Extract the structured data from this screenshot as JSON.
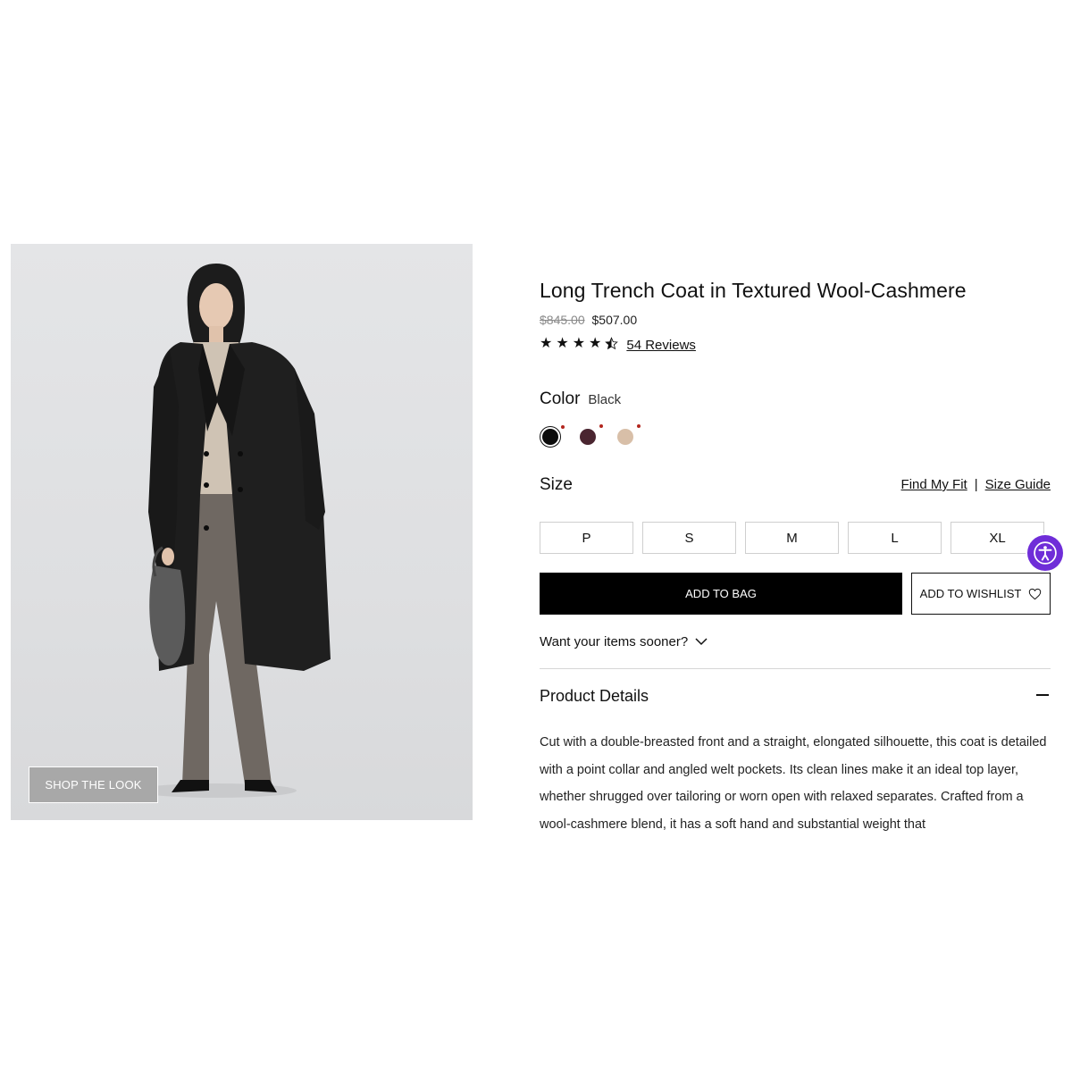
{
  "product": {
    "title": "Long Trench Coat in Textured Wool-Cashmere",
    "price_original": "$845.00",
    "price_sale": "$507.00",
    "rating": 4.5,
    "reviews_label": "54 Reviews"
  },
  "image": {
    "shop_the_look_label": "SHOP THE LOOK"
  },
  "color": {
    "label": "Color",
    "selected_value": "Black",
    "swatches": [
      {
        "name": "black",
        "hex": "#0b0b0b",
        "selected": true
      },
      {
        "name": "burgundy",
        "hex": "#4a2530",
        "selected": false
      },
      {
        "name": "camel",
        "hex": "#d8bfa8",
        "selected": false
      }
    ]
  },
  "size": {
    "label": "Size",
    "find_fit_label": "Find My Fit",
    "separator": "|",
    "size_guide_label": "Size Guide",
    "options": [
      "P",
      "S",
      "M",
      "L",
      "XL"
    ]
  },
  "actions": {
    "add_to_bag": "ADD TO BAG",
    "add_to_wishlist": "ADD TO WISHLIST"
  },
  "delivery": {
    "sooner_label": "Want your items sooner?"
  },
  "details": {
    "title": "Product Details",
    "body": "Cut with a double-breasted front and a straight, elongated silhouette, this coat is detailed with a point collar and angled welt pockets. Its clean lines make it an ideal top layer, whether shrugged over tailoring or worn open with relaxed separates. Crafted from a wool-cashmere blend, it has a soft hand and substantial weight that"
  },
  "colors": {
    "accessibility_purple": "#6f2dd8",
    "swatch_alert_red": "#b3261e",
    "primary_black": "#000000"
  }
}
